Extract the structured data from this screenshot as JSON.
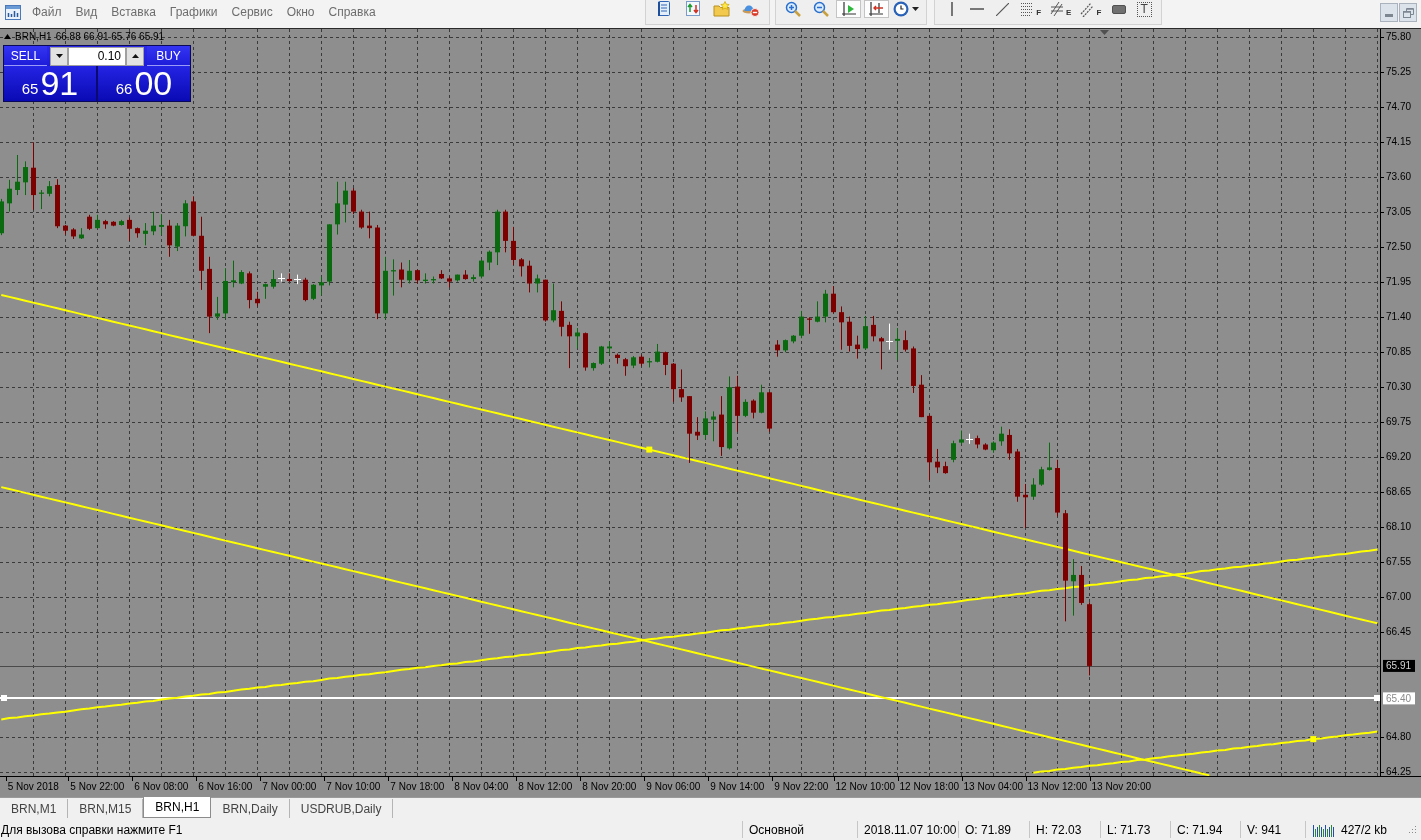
{
  "menu_bar": {
    "items": [
      "Файл",
      "Вид",
      "Вставка",
      "Графики",
      "Сервис",
      "Окно",
      "Справка"
    ]
  },
  "toolbar": {
    "chart_shift": {
      "on": true
    },
    "auto_scroll": {
      "on": true
    },
    "tool_letters": [
      "F",
      "E",
      "F",
      "T"
    ]
  },
  "chart": {
    "symbol": "BRN,H1",
    "bar_prices": "66.88 66.91 65.76 65.91",
    "one_click_trading": {
      "sell": {
        "label": "SELL",
        "price_prefix": "65",
        "price_main": "91"
      },
      "lot": "0.10",
      "buy": {
        "label": "BUY",
        "price_prefix": "66",
        "price_main": "00"
      }
    },
    "chart_data": [
      {
        "type": "candlestick",
        "categories": [
          null,
          null,
          null,
          null,
          "5 Nov 2018",
          null,
          null,
          null,
          null,
          null,
          null,
          null,
          "5 Nov 22:00",
          null,
          null,
          null,
          null,
          null,
          null,
          null,
          "6 Nov 08:00",
          null,
          null,
          null,
          null,
          null,
          null,
          null,
          "6 Nov 16:00",
          null,
          null,
          null,
          null,
          null,
          null,
          null,
          "7 Nov 00:00",
          null,
          null,
          null,
          null,
          null,
          null,
          null,
          "7 Nov 10:00",
          null,
          null,
          null,
          null,
          null,
          null,
          null,
          "7 Nov 18:00",
          null,
          null,
          null,
          null,
          null,
          null,
          null,
          "8 Nov 04:00",
          null,
          null,
          null,
          null,
          null,
          null,
          null,
          "8 Nov 12:00",
          null,
          null,
          null,
          null,
          null,
          null,
          null,
          "8 Nov 20:00",
          null,
          null,
          null,
          null,
          null,
          null,
          null,
          "9 Nov 06:00",
          null,
          null,
          null,
          null,
          null,
          null,
          null,
          "9 Nov 14:00",
          null,
          null,
          null,
          null,
          null,
          null,
          null,
          "9 Nov 22:00",
          null,
          null,
          null,
          null,
          null,
          null,
          null,
          "12 Nov 10:00",
          null,
          null,
          null,
          null,
          null,
          null,
          null,
          "12 Nov 18:00",
          null,
          null,
          null,
          null,
          null,
          null,
          null,
          "13 Nov 04:00",
          null,
          null,
          null,
          null,
          null,
          null,
          null,
          "13 Nov 12:00",
          null,
          null,
          null,
          null,
          null,
          null,
          null,
          "13 Nov 20:00",
          null,
          null,
          null,
          null,
          null,
          null,
          null,
          null,
          null,
          null,
          null,
          null,
          null,
          null,
          null,
          null,
          null,
          null,
          null,
          null,
          null,
          null,
          null,
          null,
          null,
          null,
          null,
          null,
          null,
          null,
          null,
          null
        ],
        "ohlc": [
          [
            72.71,
            73.25,
            72.68,
            73.21
          ],
          [
            73.18,
            73.55,
            73.05,
            73.41
          ],
          [
            73.39,
            73.94,
            73.31,
            73.52
          ],
          [
            73.51,
            73.84,
            73.31,
            73.75
          ],
          [
            73.74,
            74.14,
            73.08,
            73.31
          ],
          [
            73.33,
            73.39,
            73.09,
            73.35
          ],
          [
            73.33,
            73.53,
            73.29,
            73.45
          ],
          [
            73.47,
            73.56,
            72.79,
            72.82
          ],
          [
            72.83,
            72.84,
            72.69,
            72.75
          ],
          [
            72.77,
            72.79,
            72.62,
            72.66
          ],
          [
            72.63,
            72.79,
            72.62,
            72.69
          ],
          [
            72.97,
            73.0,
            72.76,
            72.78
          ],
          [
            72.79,
            73.0,
            72.78,
            72.92
          ],
          [
            72.9,
            72.92,
            72.78,
            72.85
          ],
          [
            72.89,
            72.9,
            72.82,
            72.83
          ],
          [
            72.84,
            72.92,
            72.83,
            72.9
          ],
          [
            72.92,
            72.96,
            72.59,
            72.78
          ],
          [
            72.79,
            72.8,
            72.64,
            72.71
          ],
          [
            72.7,
            72.87,
            72.52,
            72.75
          ],
          [
            72.74,
            73.05,
            72.68,
            72.83
          ],
          [
            72.81,
            73.01,
            72.68,
            72.84
          ],
          [
            72.83,
            72.92,
            72.34,
            72.52
          ],
          [
            72.5,
            72.87,
            72.43,
            72.83
          ],
          [
            72.82,
            73.23,
            72.66,
            73.18
          ],
          [
            73.21,
            73.29,
            72.66,
            72.67
          ],
          [
            72.67,
            72.97,
            71.82,
            72.12
          ],
          [
            72.15,
            72.34,
            71.14,
            71.4
          ],
          [
            71.4,
            71.71,
            71.35,
            71.45
          ],
          [
            71.45,
            72.16,
            71.37,
            71.96
          ],
          [
            71.94,
            72.28,
            71.86,
            71.97
          ],
          [
            71.92,
            72.13,
            71.91,
            72.1
          ],
          [
            72.08,
            72.11,
            71.53,
            71.66
          ],
          [
            71.68,
            71.79,
            71.56,
            71.61
          ],
          [
            71.87,
            71.92,
            71.68,
            71.91
          ],
          [
            71.87,
            72.13,
            71.84,
            71.99
          ],
          [
            72.01,
            72.08,
            71.95,
            72.01
          ],
          [
            71.99,
            72.08,
            71.94,
            71.96
          ],
          [
            71.99,
            72.06,
            71.91,
            71.99
          ],
          [
            71.98,
            72.01,
            71.64,
            71.66
          ],
          [
            71.68,
            71.91,
            71.66,
            71.9
          ],
          [
            71.89,
            72.03,
            71.73,
            71.94
          ],
          [
            71.95,
            72.85,
            71.89,
            72.85
          ],
          [
            72.85,
            73.52,
            72.69,
            73.18
          ],
          [
            73.16,
            73.52,
            72.88,
            73.38
          ],
          [
            73.38,
            73.42,
            73.01,
            73.05
          ],
          [
            73.05,
            73.08,
            72.78,
            72.8
          ],
          [
            72.83,
            73.05,
            72.63,
            72.79
          ],
          [
            72.8,
            72.84,
            71.36,
            71.45
          ],
          [
            71.45,
            72.34,
            71.36,
            72.12
          ],
          [
            72.11,
            72.3,
            71.73,
            72.13
          ],
          [
            72.14,
            72.25,
            71.86,
            71.98
          ],
          [
            71.97,
            72.29,
            71.92,
            72.12
          ],
          [
            72.13,
            72.14,
            71.92,
            71.97
          ],
          [
            71.96,
            72.08,
            71.92,
            71.98
          ],
          [
            71.97,
            72.03,
            71.92,
            71.99
          ],
          [
            72.07,
            72.13,
            71.99,
            72.0
          ],
          [
            72.0,
            72.03,
            71.86,
            71.95
          ],
          [
            71.97,
            72.06,
            71.95,
            72.06
          ],
          [
            72.06,
            72.13,
            71.98,
            71.99
          ],
          [
            71.99,
            72.06,
            71.95,
            72.02
          ],
          [
            72.03,
            72.29,
            72.0,
            72.28
          ],
          [
            72.25,
            72.44,
            72.13,
            72.42
          ],
          [
            72.41,
            73.08,
            72.21,
            73.05
          ],
          [
            73.05,
            73.08,
            72.41,
            72.59
          ],
          [
            72.59,
            72.81,
            72.21,
            72.29
          ],
          [
            72.3,
            72.32,
            72.03,
            72.19
          ],
          [
            72.2,
            72.28,
            71.78,
            71.92
          ],
          [
            71.92,
            72.06,
            71.78,
            72.0
          ],
          [
            71.98,
            71.98,
            71.32,
            71.34
          ],
          [
            71.34,
            71.92,
            71.31,
            71.5
          ],
          [
            71.49,
            71.64,
            71.09,
            71.24
          ],
          [
            71.27,
            71.32,
            70.59,
            71.09
          ],
          [
            71.09,
            71.22,
            70.9,
            71.15
          ],
          [
            71.14,
            71.15,
            70.55,
            70.6
          ],
          [
            70.59,
            70.68,
            70.55,
            70.67
          ],
          [
            70.66,
            70.94,
            70.64,
            70.93
          ],
          [
            70.9,
            71.01,
            70.81,
            70.93
          ],
          [
            70.8,
            70.82,
            70.66,
            70.75
          ],
          [
            70.73,
            70.75,
            70.47,
            70.62
          ],
          [
            70.63,
            70.78,
            70.59,
            70.76
          ],
          [
            70.77,
            70.8,
            70.62,
            70.66
          ],
          [
            70.68,
            70.75,
            70.6,
            70.7
          ],
          [
            70.69,
            70.97,
            70.68,
            70.85
          ],
          [
            70.84,
            70.85,
            70.48,
            70.64
          ],
          [
            70.66,
            70.67,
            70.06,
            70.26
          ],
          [
            70.26,
            70.57,
            70.06,
            70.13
          ],
          [
            70.15,
            70.15,
            69.1,
            69.56
          ],
          [
            69.59,
            69.82,
            69.46,
            69.53
          ],
          [
            69.54,
            69.91,
            69.47,
            69.8
          ],
          [
            69.78,
            69.91,
            69.44,
            69.83
          ],
          [
            69.86,
            70.15,
            69.21,
            69.35
          ],
          [
            69.33,
            70.46,
            69.31,
            70.29
          ],
          [
            70.3,
            70.47,
            69.59,
            69.84
          ],
          [
            69.84,
            70.1,
            69.82,
            70.06
          ],
          [
            70.08,
            70.1,
            69.8,
            69.89
          ],
          [
            69.89,
            70.33,
            69.88,
            70.21
          ],
          [
            70.21,
            70.22,
            69.59,
            69.64
          ],
          [
            70.96,
            71.03,
            70.77,
            70.87
          ],
          [
            70.87,
            71.04,
            70.84,
            71.03
          ],
          [
            71.01,
            71.11,
            70.98,
            71.1
          ],
          [
            71.1,
            71.49,
            71.06,
            71.4
          ],
          [
            71.37,
            71.39,
            71.13,
            71.35
          ],
          [
            71.32,
            71.64,
            71.31,
            71.4
          ],
          [
            71.4,
            71.82,
            71.31,
            71.76
          ],
          [
            71.76,
            71.88,
            71.45,
            71.47
          ],
          [
            71.47,
            71.56,
            70.88,
            71.31
          ],
          [
            71.32,
            71.4,
            70.85,
            70.94
          ],
          [
            70.96,
            71.1,
            70.74,
            70.89
          ],
          [
            70.9,
            71.41,
            70.88,
            71.25
          ],
          [
            71.27,
            71.41,
            71.01,
            71.09
          ],
          [
            71.06,
            71.08,
            70.57,
            71.01
          ],
          [
            71.01,
            71.29,
            70.88,
            71.01
          ],
          [
            71.02,
            71.22,
            70.72,
            71.05
          ],
          [
            71.03,
            71.18,
            70.85,
            70.88
          ],
          [
            70.9,
            70.93,
            70.2,
            70.31
          ],
          [
            70.33,
            70.48,
            69.82,
            69.82
          ],
          [
            69.84,
            69.86,
            68.83,
            69.11
          ],
          [
            69.12,
            69.32,
            68.94,
            69.03
          ],
          [
            69.05,
            69.12,
            68.93,
            68.94
          ],
          [
            69.15,
            69.45,
            69.11,
            69.41
          ],
          [
            69.42,
            69.61,
            69.39,
            69.47
          ],
          [
            69.47,
            69.56,
            69.4,
            69.47
          ],
          [
            69.49,
            69.53,
            69.33,
            69.39
          ],
          [
            69.39,
            69.41,
            69.3,
            69.31
          ],
          [
            69.3,
            69.44,
            69.26,
            69.42
          ],
          [
            69.44,
            69.67,
            69.37,
            69.56
          ],
          [
            69.54,
            69.63,
            69.15,
            69.25
          ],
          [
            69.28,
            69.32,
            68.49,
            68.57
          ],
          [
            68.6,
            68.77,
            68.08,
            68.56
          ],
          [
            68.57,
            68.86,
            68.52,
            68.76
          ],
          [
            68.76,
            69.04,
            68.74,
            69.0
          ],
          [
            68.99,
            69.42,
            68.98,
            69.03
          ],
          [
            69.02,
            69.15,
            68.26,
            68.32
          ],
          [
            68.31,
            68.36,
            66.61,
            67.25
          ],
          [
            67.24,
            67.59,
            66.7,
            67.34
          ],
          [
            67.34,
            67.48,
            66.87,
            66.9
          ],
          [
            66.88,
            66.91,
            65.76,
            65.91
          ],
          null,
          null,
          null,
          null,
          null,
          null,
          null,
          null,
          null,
          null,
          null,
          null,
          null,
          null,
          null,
          null,
          null,
          null,
          null,
          null,
          null,
          null,
          null,
          null,
          null,
          null,
          null,
          null,
          null,
          null,
          null,
          null,
          null,
          null,
          null,
          null
        ],
        "ylim": [
          64.18,
          75.92
        ],
        "yticks": [
          {
            "value": 75.8,
            "label": "75.80"
          },
          {
            "value": 75.25,
            "label": "75.25"
          },
          {
            "value": 74.7,
            "label": "74.70"
          },
          {
            "value": 74.15,
            "label": "74.15"
          },
          {
            "value": 73.6,
            "label": "73.60"
          },
          {
            "value": 73.05,
            "label": "73.05"
          },
          {
            "value": 72.5,
            "label": "72.50"
          },
          {
            "value": 71.95,
            "label": "71.95"
          },
          {
            "value": 71.4,
            "label": "71.40"
          },
          {
            "value": 70.85,
            "label": "70.85"
          },
          {
            "value": 70.3,
            "label": "70.30"
          },
          {
            "value": 69.75,
            "label": "69.75"
          },
          {
            "value": 69.2,
            "label": "69.20"
          },
          {
            "value": 68.65,
            "label": "68.65"
          },
          {
            "value": 68.1,
            "label": "68.10"
          },
          {
            "value": 67.55,
            "label": "67.55"
          },
          {
            "value": 67,
            "label": "67.00"
          },
          {
            "value": 66.45,
            "label": "66.45"
          },
          {
            "value": 64.8,
            "label": "64.80"
          },
          {
            "value": 64.25,
            "label": "64.25"
          }
        ],
        "grid": true,
        "series": [
          {
            "type": "line",
            "color": "#ffff00",
            "values": [
              71.74,
              71.71,
              71.68,
              71.65,
              71.62,
              71.59,
              71.56,
              71.53,
              71.5,
              71.47,
              71.44,
              71.41,
              71.38,
              71.35,
              71.32,
              71.29,
              71.26,
              71.23,
              71.2,
              71.17,
              71.14,
              71.11,
              71.08,
              71.05,
              71.02,
              70.99,
              70.96,
              70.93,
              70.9,
              70.87,
              70.84,
              70.81,
              70.78,
              70.75,
              70.72,
              70.69,
              70.66,
              70.63,
              70.6,
              70.57,
              70.54,
              70.51,
              70.48,
              70.45,
              70.42,
              70.39,
              70.36,
              70.33,
              70.3,
              70.27,
              70.24,
              70.21,
              70.18,
              70.15,
              70.12,
              70.09,
              70.06,
              70.03,
              70.0,
              69.97,
              69.94,
              69.91,
              69.88,
              69.85,
              69.82,
              69.79,
              69.76,
              69.73,
              69.7,
              69.67,
              69.64,
              69.61,
              69.58,
              69.55,
              69.52,
              69.49,
              69.46,
              69.43,
              69.4,
              69.37,
              69.34,
              69.31,
              69.28,
              69.25,
              69.22,
              69.19,
              69.16,
              69.13,
              69.1,
              69.07,
              69.04,
              69.01,
              68.98,
              68.95,
              68.92,
              68.89,
              68.86,
              68.83,
              68.8,
              68.77,
              68.74,
              68.71,
              68.68,
              68.65,
              68.62,
              68.59,
              68.56,
              68.53,
              68.5,
              68.47,
              68.44,
              68.41,
              68.38,
              68.35,
              68.32,
              68.29,
              68.26,
              68.23,
              68.2,
              68.17,
              68.14,
              68.11,
              68.08,
              68.05,
              68.02,
              67.99,
              67.96,
              67.93,
              67.9,
              67.87,
              67.84,
              67.81,
              67.78,
              67.75,
              67.72,
              67.69,
              67.66,
              67.63,
              67.6,
              67.57,
              67.54,
              67.51,
              67.48,
              67.45,
              67.42,
              67.39,
              67.36,
              67.33,
              67.3,
              67.27,
              67.24,
              67.21,
              67.18,
              67.15,
              67.12,
              67.09,
              67.06,
              67.03,
              67.0,
              66.97,
              66.94,
              66.91,
              66.88,
              66.85,
              66.82,
              66.79,
              66.76,
              66.73,
              66.7,
              66.67,
              66.64,
              66.61,
              66.58
            ]
          },
          {
            "type": "line",
            "color": "#ffff00",
            "values": [
              68.72,
              68.69,
              68.66,
              68.63,
              68.6,
              68.57,
              68.54,
              68.51,
              68.48,
              68.45,
              68.42,
              68.39,
              68.36,
              68.33,
              68.3,
              68.27,
              68.24,
              68.21,
              68.18,
              68.15,
              68.12,
              68.09,
              68.06,
              68.03,
              68.0,
              67.97,
              67.94,
              67.91,
              67.88,
              67.85,
              67.82,
              67.79,
              67.76,
              67.73,
              67.7,
              67.67,
              67.64,
              67.61,
              67.58,
              67.55,
              67.52,
              67.49,
              67.46,
              67.43,
              67.4,
              67.37,
              67.34,
              67.31,
              67.28,
              67.25,
              67.22,
              67.19,
              67.16,
              67.13,
              67.1,
              67.07,
              67.04,
              67.01,
              66.98,
              66.95,
              66.92,
              66.89,
              66.86,
              66.83,
              66.8,
              66.77,
              66.74,
              66.71,
              66.68,
              66.65,
              66.62,
              66.59,
              66.56,
              66.53,
              66.5,
              66.47,
              66.44,
              66.41,
              66.38,
              66.35,
              66.32,
              66.29,
              66.26,
              66.23,
              66.2,
              66.17,
              66.14,
              66.11,
              66.08,
              66.05,
              66.02,
              65.99,
              65.96,
              65.93,
              65.9,
              65.87,
              65.84,
              65.81,
              65.78,
              65.75,
              65.72,
              65.69,
              65.66,
              65.63,
              65.6,
              65.57,
              65.54,
              65.51,
              65.48,
              65.45,
              65.42,
              65.39,
              65.36,
              65.33,
              65.3,
              65.27,
              65.24,
              65.21,
              65.18,
              65.15,
              65.12,
              65.09,
              65.06,
              65.03,
              65.0,
              64.97,
              64.94,
              64.91,
              64.88,
              64.85,
              64.82,
              64.79,
              64.76,
              64.73,
              64.7,
              64.67,
              64.64,
              64.61,
              64.58,
              64.55,
              64.52,
              64.49,
              64.46,
              64.43,
              64.4,
              64.37,
              64.34,
              64.31,
              64.28,
              64.25,
              64.22,
              64.19,
              null,
              null,
              null,
              null,
              null,
              null,
              null,
              null,
              null,
              null,
              null,
              null,
              null,
              null,
              null,
              null,
              null,
              null,
              null,
              null,
              null
            ]
          },
          {
            "type": "line",
            "color": "#ffff00",
            "values": [
              65.07,
              65.09,
              65.1,
              65.12,
              65.13,
              65.15,
              65.16,
              65.18,
              65.19,
              65.21,
              65.23,
              65.24,
              65.26,
              65.27,
              65.29,
              65.3,
              65.32,
              65.33,
              65.35,
              65.36,
              65.38,
              65.4,
              65.41,
              65.43,
              65.44,
              65.46,
              65.47,
              65.49,
              65.5,
              65.52,
              65.54,
              65.55,
              65.57,
              65.58,
              65.6,
              65.61,
              65.63,
              65.64,
              65.66,
              65.67,
              65.69,
              65.71,
              65.72,
              65.74,
              65.75,
              65.77,
              65.78,
              65.8,
              65.81,
              65.83,
              65.85,
              65.86,
              65.88,
              65.89,
              65.91,
              65.92,
              65.94,
              65.95,
              65.97,
              65.98,
              66.0,
              66.02,
              66.03,
              66.05,
              66.06,
              66.08,
              66.09,
              66.11,
              66.12,
              66.14,
              66.16,
              66.17,
              66.19,
              66.2,
              66.22,
              66.23,
              66.25,
              66.26,
              66.28,
              66.29,
              66.31,
              66.33,
              66.34,
              66.36,
              66.37,
              66.39,
              66.4,
              66.42,
              66.43,
              66.45,
              66.47,
              66.48,
              66.5,
              66.51,
              66.53,
              66.54,
              66.56,
              66.57,
              66.59,
              66.6,
              66.62,
              66.64,
              66.65,
              66.67,
              66.68,
              66.7,
              66.71,
              66.73,
              66.74,
              66.76,
              66.78,
              66.79,
              66.81,
              66.82,
              66.84,
              66.85,
              66.87,
              66.88,
              66.9,
              66.91,
              66.93,
              66.95,
              66.96,
              66.98,
              66.99,
              67.01,
              67.02,
              67.04,
              67.05,
              67.07,
              67.09,
              67.1,
              67.12,
              67.13,
              67.15,
              67.16,
              67.18,
              67.19,
              67.21,
              67.22,
              67.24,
              67.26,
              67.27,
              67.29,
              67.3,
              67.32,
              67.33,
              67.35,
              67.36,
              67.38,
              67.4,
              67.41,
              67.43,
              67.44,
              67.46,
              67.47,
              67.49,
              67.5,
              67.52,
              67.53,
              67.55,
              67.57,
              67.58,
              67.6,
              67.61,
              67.63,
              67.64,
              67.66,
              67.67,
              67.69,
              67.71,
              67.72,
              67.74
            ]
          },
          {
            "type": "line",
            "color": "#ffff00",
            "values": [
              null,
              null,
              null,
              null,
              null,
              null,
              null,
              null,
              null,
              null,
              null,
              null,
              null,
              null,
              null,
              null,
              null,
              null,
              null,
              null,
              null,
              null,
              null,
              null,
              null,
              null,
              null,
              null,
              null,
              null,
              null,
              null,
              null,
              null,
              null,
              null,
              null,
              null,
              null,
              null,
              null,
              null,
              null,
              null,
              null,
              null,
              null,
              null,
              null,
              null,
              null,
              null,
              null,
              null,
              null,
              null,
              null,
              null,
              null,
              null,
              null,
              null,
              null,
              null,
              null,
              null,
              null,
              null,
              null,
              null,
              null,
              null,
              null,
              null,
              null,
              null,
              null,
              null,
              null,
              null,
              null,
              null,
              null,
              null,
              null,
              null,
              null,
              null,
              null,
              null,
              null,
              null,
              null,
              null,
              null,
              null,
              null,
              null,
              null,
              null,
              null,
              null,
              null,
              null,
              null,
              null,
              null,
              null,
              null,
              null,
              null,
              null,
              null,
              null,
              null,
              null,
              null,
              null,
              null,
              null,
              null,
              null,
              null,
              null,
              null,
              null,
              null,
              null,
              null,
              64.23,
              64.25,
              64.26,
              64.28,
              64.29,
              64.31,
              64.32,
              64.34,
              64.35,
              64.37,
              64.38,
              64.4,
              64.41,
              64.43,
              64.44,
              64.46,
              64.47,
              64.49,
              64.5,
              64.52,
              64.53,
              64.55,
              64.56,
              64.58,
              64.59,
              64.61,
              64.62,
              64.64,
              64.65,
              64.67,
              64.68,
              64.7,
              64.71,
              64.73,
              64.74,
              64.76,
              64.77,
              64.79,
              64.8,
              64.82,
              64.83,
              64.85,
              64.86,
              64.88
            ]
          }
        ],
        "ref_lines": [
          {
            "axis": "y",
            "value": 65.91,
            "label": "65.91",
            "color": "#4a4a4a"
          },
          {
            "axis": "y",
            "value": 65.4,
            "label": "65.40",
            "color": "#ffffff"
          }
        ]
      }
    ]
  },
  "tabs": [
    {
      "label": "BRN,M1",
      "selected": false
    },
    {
      "label": "BRN,M15",
      "selected": false
    },
    {
      "label": "BRN,H1",
      "selected": true
    },
    {
      "label": "BRN,Daily",
      "selected": false
    },
    {
      "label": "USDRUB,Daily",
      "selected": false
    }
  ],
  "status_bar": {
    "hint": "Для вызова справки нажмите F1",
    "profile": "Основной",
    "bar_time": "2018.11.07 10:00",
    "open": "O: 71.89",
    "high": "H: 72.03",
    "low": "L: 71.73",
    "close": "C: 71.94",
    "volume": "V: 941",
    "traffic": "427/2 kb"
  }
}
